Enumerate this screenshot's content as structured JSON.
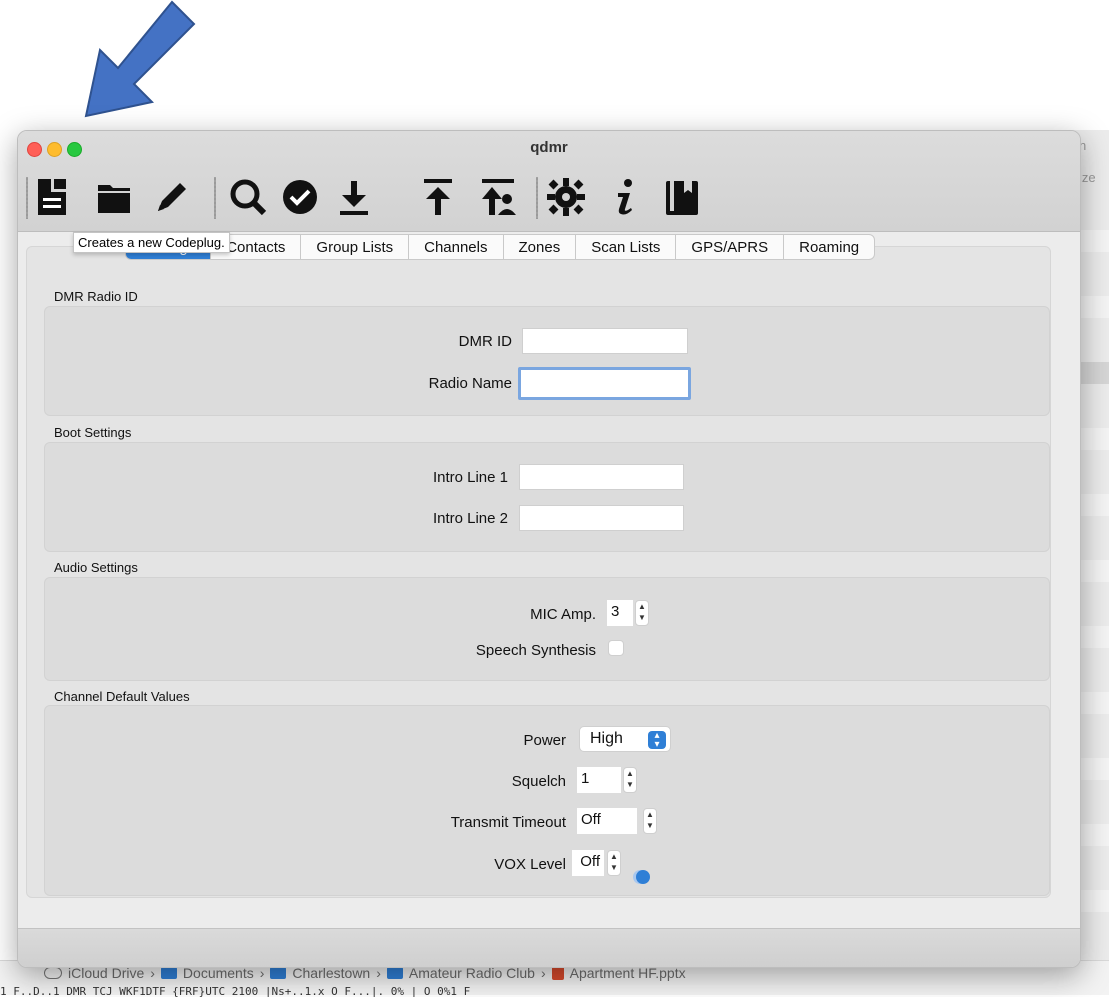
{
  "app_title": "qdmr",
  "tooltip_text": "Creates a new Codeplug.",
  "tabs": [
    {
      "label": "Settings",
      "active": true
    },
    {
      "label": "Contacts",
      "active": false
    },
    {
      "label": "Group Lists",
      "active": false
    },
    {
      "label": "Channels",
      "active": false
    },
    {
      "label": "Zones",
      "active": false
    },
    {
      "label": "Scan Lists",
      "active": false
    },
    {
      "label": "GPS/APRS",
      "active": false
    },
    {
      "label": "Roaming",
      "active": false
    }
  ],
  "toolbar": {
    "icons": [
      "new-codeplug-icon",
      "open-folder-icon",
      "edit-pencil-icon",
      "search-icon",
      "verify-check-icon",
      "download-icon",
      "upload-icon",
      "upload-callsign-db-icon",
      "settings-gear-icon",
      "info-icon",
      "help-book-icon"
    ]
  },
  "sections": {
    "dmr_radio_id": {
      "title": "DMR Radio ID",
      "dmr_id_label": "DMR ID",
      "dmr_id_value": "",
      "radio_name_label": "Radio Name",
      "radio_name_value": ""
    },
    "boot_settings": {
      "title": "Boot Settings",
      "intro1_label": "Intro Line 1",
      "intro1_value": "",
      "intro2_label": "Intro Line 2",
      "intro2_value": ""
    },
    "audio_settings": {
      "title": "Audio Settings",
      "mic_amp_label": "MIC Amp.",
      "mic_amp_value": "3",
      "speech_label": "Speech Synthesis",
      "speech_checked": false
    },
    "channel_defaults": {
      "title": "Channel Default Values",
      "power_label": "Power",
      "power_value": "High",
      "squelch_label": "Squelch",
      "squelch_value": "1",
      "tx_timeout_label": "Transmit Timeout",
      "tx_timeout_value": "Off",
      "vox_label": "VOX Level",
      "vox_value": "Off"
    }
  },
  "background": {
    "cutoff_text_1": "n",
    "cutoff_text_2": "ize",
    "breadcrumb": [
      "iCloud Drive",
      "Documents",
      "Charlestown",
      "Amateur Radio Club",
      "Apartment HF.pptx"
    ],
    "under_text": "1 F..D..1      DMR TCJ      WKF1DTF            {FRF}UTC 2100   |Ns+..1.x  O  F...|. 0%   | O  0%1 F"
  },
  "colors": {
    "accent": "#2f7fd6",
    "arrow": "#4472c4",
    "window_bg": "#ececec",
    "group_bg": "#dcdcdc"
  }
}
